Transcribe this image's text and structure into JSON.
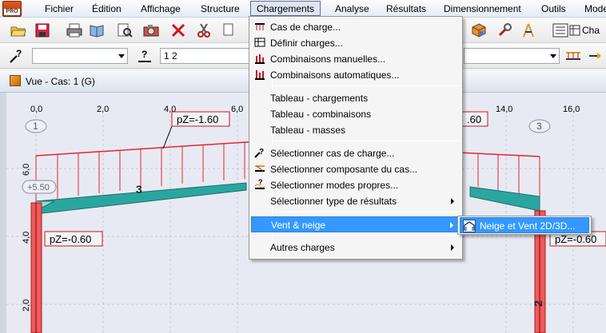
{
  "app": {
    "badge": "PRO"
  },
  "menubar": {
    "items": [
      {
        "label": "Fichier"
      },
      {
        "label": "Édition"
      },
      {
        "label": "Affichage"
      },
      {
        "label": "Structure"
      },
      {
        "label": "Chargements"
      },
      {
        "label": "Analyse"
      },
      {
        "label": "Résultats"
      },
      {
        "label": "Dimensionnement"
      },
      {
        "label": "Outils"
      },
      {
        "label": "Mode"
      }
    ]
  },
  "toolbar": {
    "right_label": "Cha",
    "combo_load_case": "",
    "combo_lines": "1 2",
    "question_glyph": "?"
  },
  "view": {
    "title": "Vue - Cas: 1 (G)"
  },
  "canvas": {
    "x_ticks": [
      "0,0",
      "2,0",
      "4,0",
      "6,0",
      "14,0",
      "16,0"
    ],
    "y_ticks": [
      "6,0",
      "4,0",
      "2,0"
    ],
    "node_labels": [
      "1",
      "3"
    ],
    "bar_labels": [
      "3",
      "2"
    ],
    "elevation_tag": "+5.50",
    "loads": {
      "roof_left": "pZ=-1.60",
      "roof_right_partial": ".60",
      "col_left": "pZ=-0.60",
      "col_right": "pZ=-0.60"
    }
  },
  "chargements_menu": {
    "items": [
      {
        "label": "Cas de charge...",
        "icon": "load-case-icon"
      },
      {
        "label": "Définir charges...",
        "icon": "define-loads-icon"
      },
      {
        "label": "Combinaisons manuelles...",
        "icon": "manual-combination-icon"
      },
      {
        "label": "Combinaisons automatiques...",
        "icon": "auto-combination-icon"
      },
      {
        "label": "Tableau - chargements"
      },
      {
        "label": "Tableau - combinaisons"
      },
      {
        "label": "Tableau - masses"
      },
      {
        "label": "Sélectionner cas de charge...",
        "icon": "select-case-icon"
      },
      {
        "label": "Sélectionner composante du cas...",
        "icon": "select-component-icon"
      },
      {
        "label": "Sélectionner modes propres...",
        "icon": "select-modes-icon"
      },
      {
        "label": "Sélectionner type de résultats"
      },
      {
        "label": "Vent & neige"
      },
      {
        "label": "Autres charges"
      }
    ]
  },
  "vent_submenu": {
    "items": [
      {
        "label": "Neige et Vent 2D/3D...",
        "icon": "snow-wind-icon"
      }
    ]
  },
  "colors": {
    "menu_highlight": "#3399ff",
    "load_red": "#e8242c",
    "beam_teal": "#2aa6a0",
    "column_red": "#f05a5a"
  }
}
